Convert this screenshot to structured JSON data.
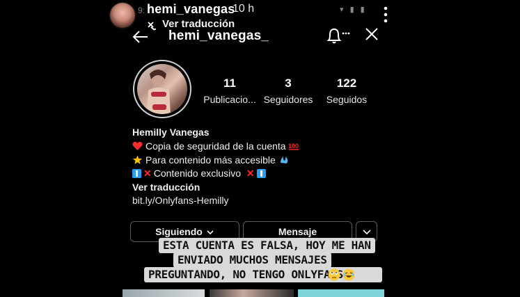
{
  "story": {
    "username": "hemi_vanegas",
    "time": "10 h",
    "ghost_time": "9:",
    "translate": "Ver traducción"
  },
  "profile": {
    "username": "hemi_vanegas_",
    "stats": [
      {
        "value": "11",
        "label": "Publicacio..."
      },
      {
        "value": "3",
        "label": "Seguidores"
      },
      {
        "value": "122",
        "label": "Seguidos"
      }
    ],
    "name": "Hemilly Vanegas",
    "bio_line1": "Copia de seguridad de la cuenta",
    "bio_line2": "Para contenido más accesible",
    "bio_line3": "Contenido exclusivo",
    "translate": "Ver traducción",
    "link": "bit.ly/Onlyfans-Hemilly"
  },
  "buttons": {
    "following": "Siguiendo",
    "message": "Mensaje"
  },
  "caption": {
    "line1": "ESTA CUENTA ES FALSA, HOY ME HAN",
    "line2": "ENVIADO MUCHOS MENSAJES",
    "line3": "PREGUNTANDO, NO TENGO ONLYFANS"
  },
  "icons": [
    "more-vertical-icon",
    "back-arrow-icon",
    "bell-icon",
    "close-icon",
    "translate-icon",
    "chevron-down-icon",
    "heart-emoji",
    "star-emoji",
    "cross-emoji",
    "info-emoji",
    "splash-emoji",
    "hundred-emoji",
    "rolling-eyes-emoji",
    "laughing-emoji"
  ],
  "colors": {
    "background": "#000000",
    "caption_bg": "#d9d9d9",
    "heart": "#ff2d2d",
    "star": "#ffc107",
    "info_blue": "#2a9df4",
    "highlight_teal": "#7fd3d9"
  }
}
